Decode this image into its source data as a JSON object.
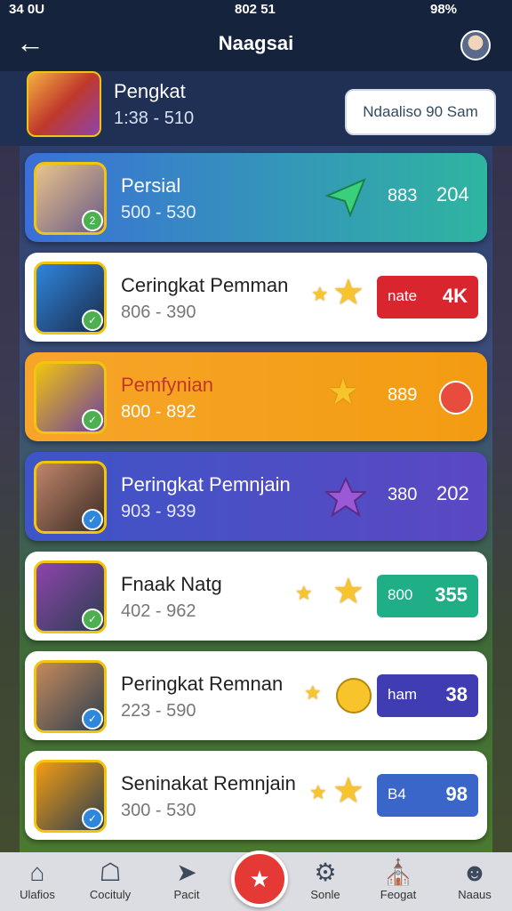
{
  "status": {
    "left": "34 0U",
    "time": "802 51",
    "battery": "98%"
  },
  "header": {
    "title": "Naagsai"
  },
  "top": {
    "name": "Pengkat",
    "range": "1:38 - 510",
    "button": "Ndaaliso 90 Sam"
  },
  "rows": [
    {
      "name": "Persial",
      "range": "500 - 530",
      "v1": "883",
      "v2": "204",
      "style": "blue"
    },
    {
      "name": "Ceringkat Pemman",
      "range": "806 - 390",
      "pill_l": "nate",
      "pill_r": "4K",
      "style": "white",
      "pill": "#d9252e"
    },
    {
      "name": "Pemfynian",
      "range": "800 - 892",
      "v1": "889",
      "style": "orange"
    },
    {
      "name": "Peringkat Pemnjain",
      "range": "903 - 939",
      "v1": "380",
      "v2": "202",
      "style": "purple"
    },
    {
      "name": "Fnaak Natg",
      "range": "402 - 962",
      "pill_l": "800",
      "pill_r": "355",
      "style": "white",
      "pill": "#1fae86"
    },
    {
      "name": "Peringkat Remnan",
      "range": "223 - 590",
      "pill_l": "ham",
      "pill_r": "38",
      "style": "white",
      "pill": "#3f3db1"
    },
    {
      "name": "Seninakat Remnjain",
      "range": "300 - 530",
      "pill_l": "B4",
      "pill_r": "98",
      "style": "white",
      "pill": "#3a66c9"
    }
  ],
  "nav": [
    {
      "label": "Ulafios",
      "icon": "house"
    },
    {
      "label": "Cocituly",
      "icon": "home"
    },
    {
      "label": "Pacit",
      "icon": "send"
    },
    {
      "label": "",
      "icon": "star"
    },
    {
      "label": "Sonle",
      "icon": "bell"
    },
    {
      "label": "Feogat",
      "icon": "shop"
    },
    {
      "label": "Naaus",
      "icon": "user"
    }
  ]
}
